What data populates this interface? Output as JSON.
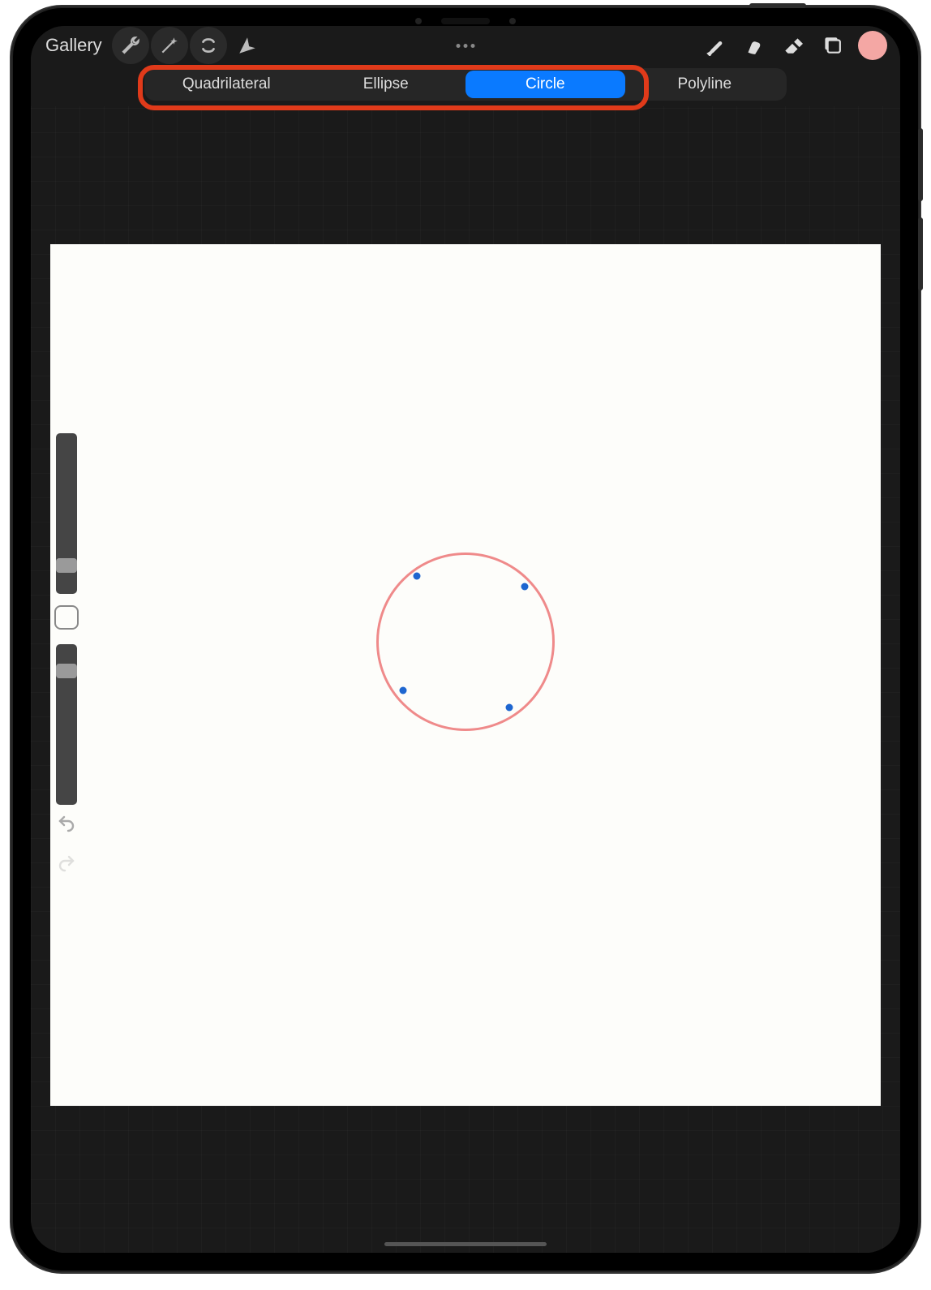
{
  "toolbar": {
    "gallery_label": "Gallery",
    "icons": {
      "wrench": "wrench-icon",
      "wand": "wand-icon",
      "selection": "selection-icon",
      "arrow": "arrow-icon",
      "brush": "brush-icon",
      "smudge": "smudge-icon",
      "eraser": "eraser-icon",
      "layers": "layers-icon"
    },
    "color_swatch": "#f4a7a4"
  },
  "shape_tabs": {
    "items": [
      "Quadrilateral",
      "Ellipse",
      "Circle",
      "Polyline"
    ],
    "active_index": 2
  },
  "canvas": {
    "shape": {
      "type": "circle",
      "stroke": "#ef8a8a",
      "handle_color": "#1e66d0",
      "handles": 4
    }
  },
  "sidebar": {
    "brush_size_slider_pos_pct": 78,
    "opacity_slider_pos_pct": 12
  }
}
